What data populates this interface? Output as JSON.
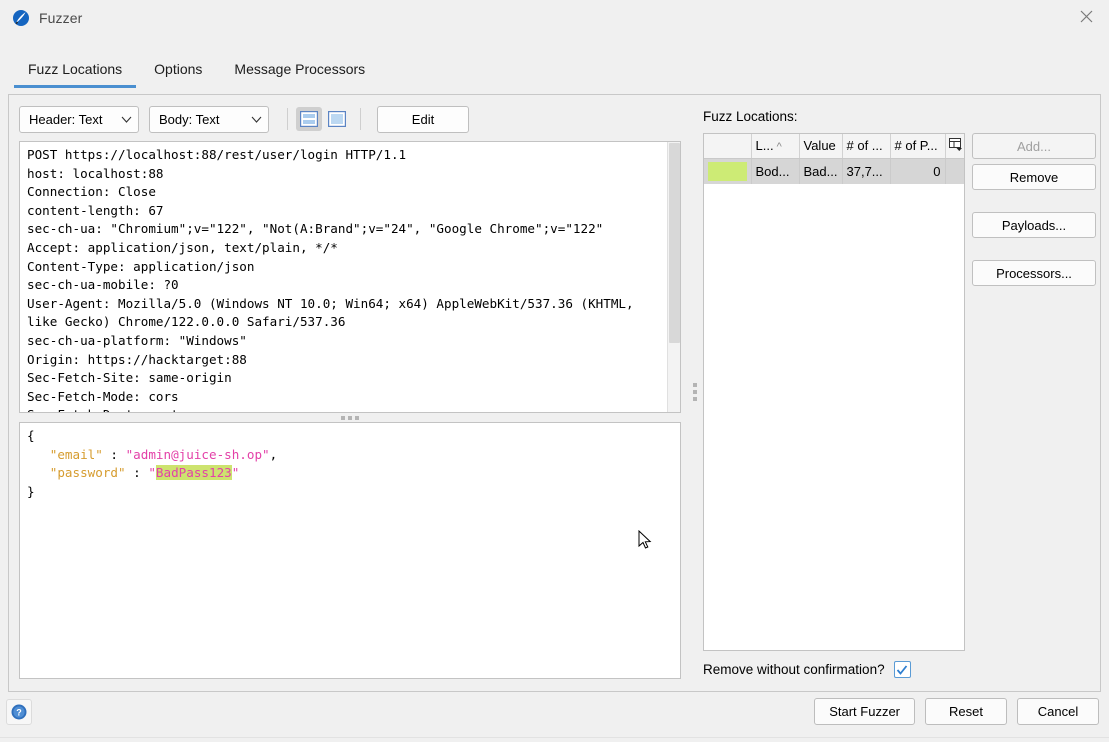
{
  "window": {
    "title": "Fuzzer",
    "logo_icon": "zap-logo-icon",
    "close_icon": "close-icon"
  },
  "tabs": [
    {
      "label": "Fuzz Locations",
      "active": true
    },
    {
      "label": "Options",
      "active": false
    },
    {
      "label": "Message Processors",
      "active": false
    }
  ],
  "toolbar": {
    "header_view": "Header: Text",
    "body_view": "Body: Text",
    "split_view_icon": "split-view-icon",
    "single_view_icon": "single-view-icon",
    "edit_label": "Edit"
  },
  "request": {
    "text": "POST https://localhost:88/rest/user/login HTTP/1.1\nhost: localhost:88\nConnection: Close\ncontent-length: 67\nsec-ch-ua: \"Chromium\";v=\"122\", \"Not(A:Brand\";v=\"24\", \"Google Chrome\";v=\"122\"\nAccept: application/json, text/plain, */*\nContent-Type: application/json\nsec-ch-ua-mobile: ?0\nUser-Agent: Mozilla/5.0 (Windows NT 10.0; Win64; x64) AppleWebKit/537.36 (KHTML,\nlike Gecko) Chrome/122.0.0.0 Safari/537.36\nsec-ch-ua-platform: \"Windows\"\nOrigin: https://hacktarget:88\nSec-Fetch-Site: same-origin\nSec-Fetch-Mode: cors\nSec-Fetch-Dest: empty"
  },
  "body": {
    "open_brace": "{",
    "line1_key": "\"email\"",
    "line1_sep": " : ",
    "line1_value": "\"admin@juice-sh.op\"",
    "line1_comma": ",",
    "line2_key": "\"password\"",
    "line2_sep": " : ",
    "line2_quote_open": "\"",
    "line2_highlighted": "BadPass123",
    "line2_quote_close": "\"",
    "close_brace": "}",
    "highlight_color": "#cde36f",
    "key_color": "#d69c2f",
    "string_color": "#e341a8"
  },
  "fuzz_locations": {
    "label": "Fuzz Locations:",
    "columns": [
      {
        "label": "",
        "key": "swatch"
      },
      {
        "label": "L...",
        "key": "location",
        "sorted": "asc",
        "sort_glyph": "^"
      },
      {
        "label": "Value",
        "key": "value"
      },
      {
        "label": "# of ...",
        "key": "payloads"
      },
      {
        "label": "# of P...",
        "key": "processors"
      }
    ],
    "config_icon": "column-settings-icon",
    "rows": [
      {
        "swatch_color": "#cdeb75",
        "location": "Bod...",
        "value": "Bad...",
        "payloads": "37,7...",
        "processors": "0",
        "selected": true
      }
    ],
    "buttons": [
      {
        "label": "Add...",
        "enabled": false
      },
      {
        "label": "Remove",
        "enabled": true
      },
      {
        "label": "Payloads...",
        "enabled": true
      },
      {
        "label": "Processors...",
        "enabled": true
      }
    ],
    "confirm_label": "Remove without confirmation?",
    "confirm_checked": true
  },
  "footer": {
    "help_icon": "help-icon",
    "buttons": [
      {
        "label": "Start Fuzzer"
      },
      {
        "label": "Reset"
      },
      {
        "label": "Cancel"
      }
    ]
  }
}
